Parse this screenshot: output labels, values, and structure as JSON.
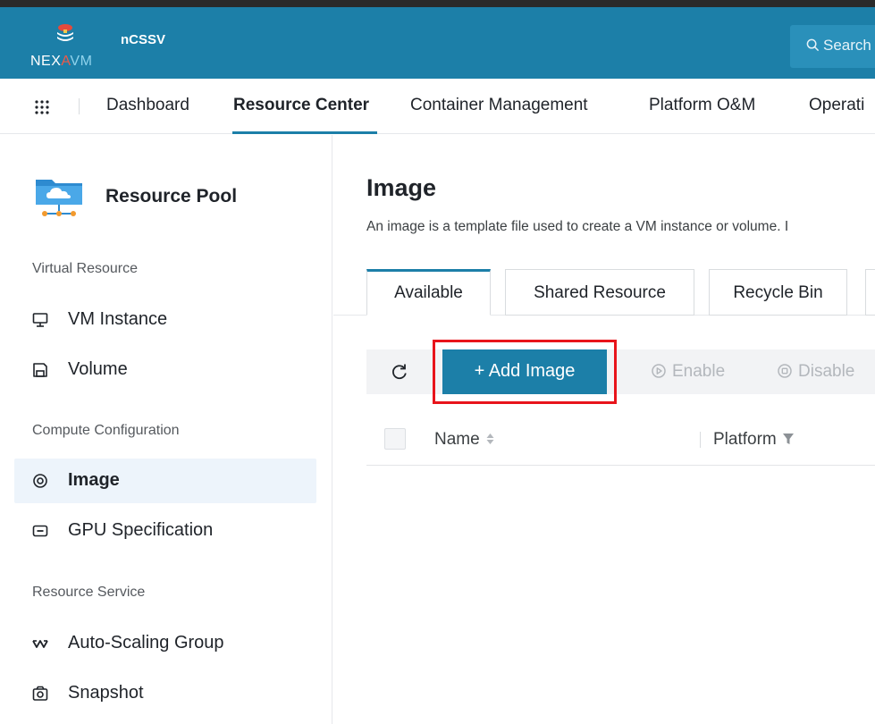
{
  "brand": {
    "logo_parts": [
      "NEX",
      "A",
      "VM"
    ],
    "app_name": "nCSSV",
    "color": "#1c7fa8"
  },
  "search": {
    "placeholder": "Search"
  },
  "nav": {
    "items": [
      "Dashboard",
      "Resource Center",
      "Container Management",
      "Platform O&M",
      "Operati"
    ],
    "active": "Resource Center"
  },
  "sidebar": {
    "title": "Resource Pool",
    "groups": {
      "virtual": "Virtual Resource",
      "compute": "Compute Configuration",
      "service": "Resource Service"
    },
    "items": [
      {
        "label": "VM Instance",
        "icon": "monitor-icon"
      },
      {
        "label": "Volume",
        "icon": "disk-icon"
      },
      {
        "label": "Image",
        "icon": "image-target-icon",
        "active": true
      },
      {
        "label": "GPU Specification",
        "icon": "gpu-card-icon"
      },
      {
        "label": "Auto-Scaling Group",
        "icon": "scaling-icon"
      },
      {
        "label": "Snapshot",
        "icon": "camera-icon"
      }
    ]
  },
  "main": {
    "title": "Image",
    "description": "An image is a template file used to create a VM instance or volume. I",
    "tabs": [
      "Available",
      "Shared Resource",
      "Recycle Bin"
    ],
    "active_tab": "Available",
    "toolbar": {
      "add": "+ Add Image",
      "enable": "Enable",
      "disable": "Disable"
    },
    "table": {
      "columns": [
        "Name",
        "Platform"
      ]
    }
  }
}
